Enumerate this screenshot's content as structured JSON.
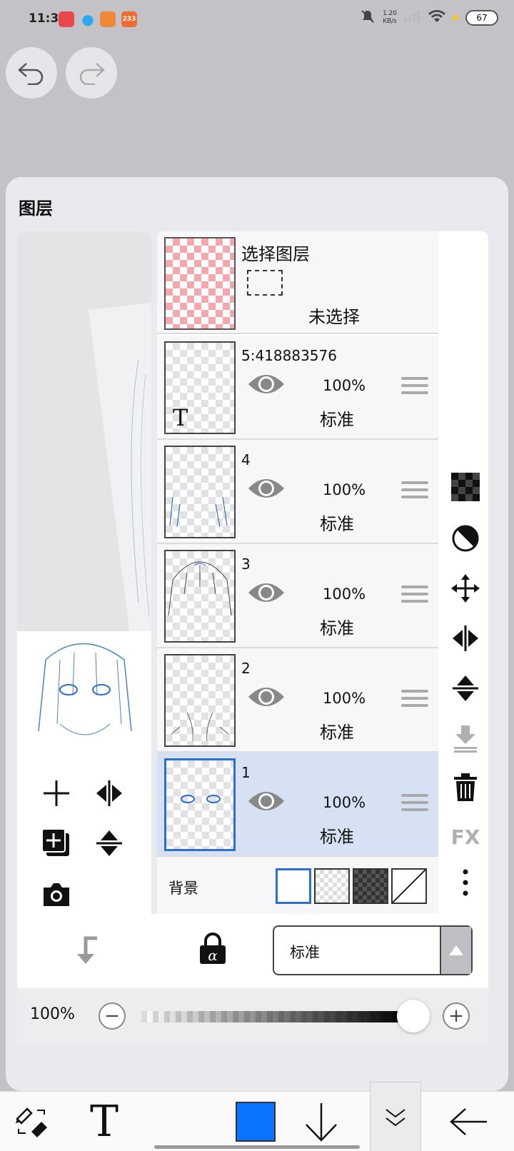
{
  "status_bar": {
    "time": "11:31",
    "net_speed_value": "1.20",
    "net_speed_unit": "KB/s",
    "battery": "67",
    "app_badge": "233"
  },
  "panel": {
    "title": "图层"
  },
  "select_layer": {
    "title": "选择图层",
    "state": "未选择"
  },
  "layers": [
    {
      "name": "5:418883576",
      "opacity": "100%",
      "mode": "标准",
      "thumb_text": "T"
    },
    {
      "name": "4",
      "opacity": "100%",
      "mode": "标准"
    },
    {
      "name": "3",
      "opacity": "100%",
      "mode": "标准"
    },
    {
      "name": "2",
      "opacity": "100%",
      "mode": "标准"
    },
    {
      "name": "1",
      "opacity": "100%",
      "mode": "标准",
      "selected": true
    }
  ],
  "background": {
    "label": "背景"
  },
  "blend_mode": {
    "value": "标准"
  },
  "opacity_control": {
    "value": "100%",
    "minus": "−",
    "plus": "+",
    "level": 1.0
  },
  "right_tools": {
    "fx_label": "FX"
  },
  "toolbar": {
    "text_tool": "T",
    "brush_color": "#0a73ff"
  },
  "colors": {
    "selected_row": "#d6e2f4",
    "accent": "#2d6fcf"
  }
}
